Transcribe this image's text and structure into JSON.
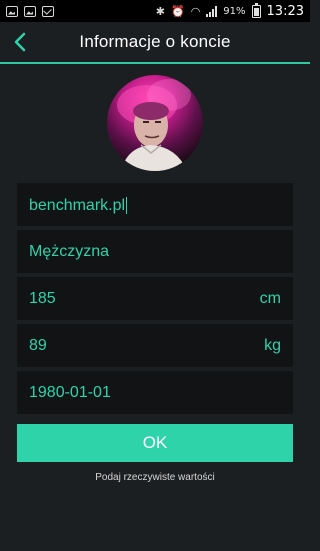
{
  "status_bar": {
    "battery": "91%",
    "time": "13:23",
    "icons": [
      "image-icon",
      "image-icon",
      "mail-icon",
      "bluetooth-icon",
      "alarm-icon",
      "wifi-icon",
      "signal-icon",
      "battery-icon"
    ]
  },
  "header": {
    "title": "Informacje o koncie",
    "back_icon": "chevron-left-icon"
  },
  "colors": {
    "accent": "#2fd3aa",
    "background": "#1c1f22",
    "field_background": "#111315"
  },
  "form": {
    "username": {
      "value": "benchmark.pl"
    },
    "gender": {
      "value": "Mężczyzna"
    },
    "height": {
      "value": "185",
      "unit": "cm"
    },
    "weight": {
      "value": "89",
      "unit": "kg"
    },
    "birthdate": {
      "value": "1980-01-01"
    }
  },
  "ok_button": {
    "label": "OK"
  },
  "hint": "Podaj rzeczywiste wartości"
}
